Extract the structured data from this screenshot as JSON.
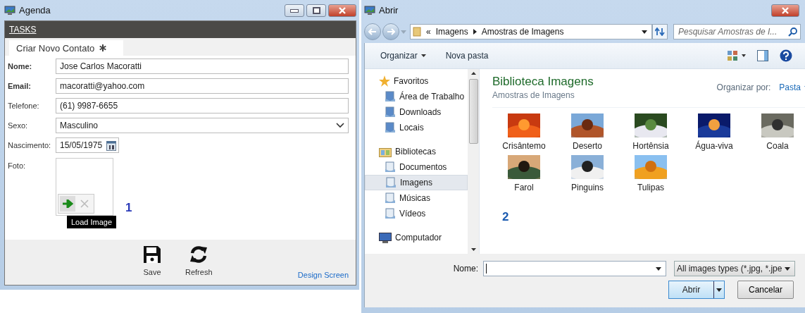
{
  "agenda_window": {
    "title": "Agenda",
    "tasks_bar": "TASKS",
    "tab": {
      "label": "Criar Novo Contato"
    },
    "fields": [
      {
        "kind": "text",
        "label": "Nome:",
        "bold": true,
        "value": "Jose Carlos Macoratti"
      },
      {
        "kind": "text",
        "label": "Email:",
        "bold": true,
        "value": "macoratti@yahoo.com"
      },
      {
        "kind": "text",
        "label": "Telefone:",
        "bold": false,
        "value": "(61) 9987-6655"
      },
      {
        "kind": "select",
        "label": "Sexo:",
        "bold": false,
        "value": "Masculino"
      },
      {
        "kind": "date",
        "label": "Nascimento:",
        "bold": false,
        "value": "15/05/1975"
      },
      {
        "label": "Foto:",
        "bold": false
      }
    ],
    "photo_tooltip": "Load Image",
    "callout": "1",
    "commands": [
      {
        "kind": "save",
        "label": "Save"
      },
      {
        "kind": "refresh",
        "label": "Refresh"
      }
    ],
    "design_link": "Design Screen"
  },
  "open_dialog": {
    "title": "Abrir",
    "breadcrumb": {
      "overflow": "«",
      "parts": [
        "Imagens",
        "Amostras de Imagens"
      ]
    },
    "search": {
      "placeholder": "Pesquisar Amostras de I..."
    },
    "toolbar": [
      "Organizar",
      "Nova pasta"
    ],
    "sidebar": {
      "items": [
        {
          "label": "Favoritos",
          "selected": false,
          "children": [
            {
              "label": "Área de Trabalho",
              "selected": false
            },
            {
              "label": "Downloads",
              "selected": false
            },
            {
              "label": "Locais",
              "selected": false
            }
          ]
        },
        {
          "label": "Bibliotecas",
          "selected": false,
          "children": [
            {
              "label": "Documentos",
              "selected": false
            },
            {
              "label": "Imagens",
              "selected": true
            },
            {
              "label": "Músicas",
              "selected": false
            },
            {
              "label": "Vídeos",
              "selected": false
            }
          ]
        },
        {
          "label": "Computador",
          "selected": false
        }
      ]
    },
    "library": {
      "title": "Biblioteca Imagens",
      "subtitle": "Amostras de Imagens",
      "arrange_label": "Organizar por:",
      "arrange_value": "Pasta"
    },
    "files": [
      {
        "name": "Crisântemo"
      },
      {
        "name": "Deserto"
      },
      {
        "name": "Hortênsia"
      },
      {
        "name": "Água-viva"
      },
      {
        "name": "Coala"
      },
      {
        "name": "Farol"
      },
      {
        "name": "Pinguins"
      },
      {
        "name": "Tulipas"
      }
    ],
    "callout": "2",
    "file_name": {
      "label": "Nome:"
    },
    "file_type": "All images types (*.jpg, *.jpe",
    "buttons": [
      "Abrir",
      "Cancelar"
    ]
  }
}
